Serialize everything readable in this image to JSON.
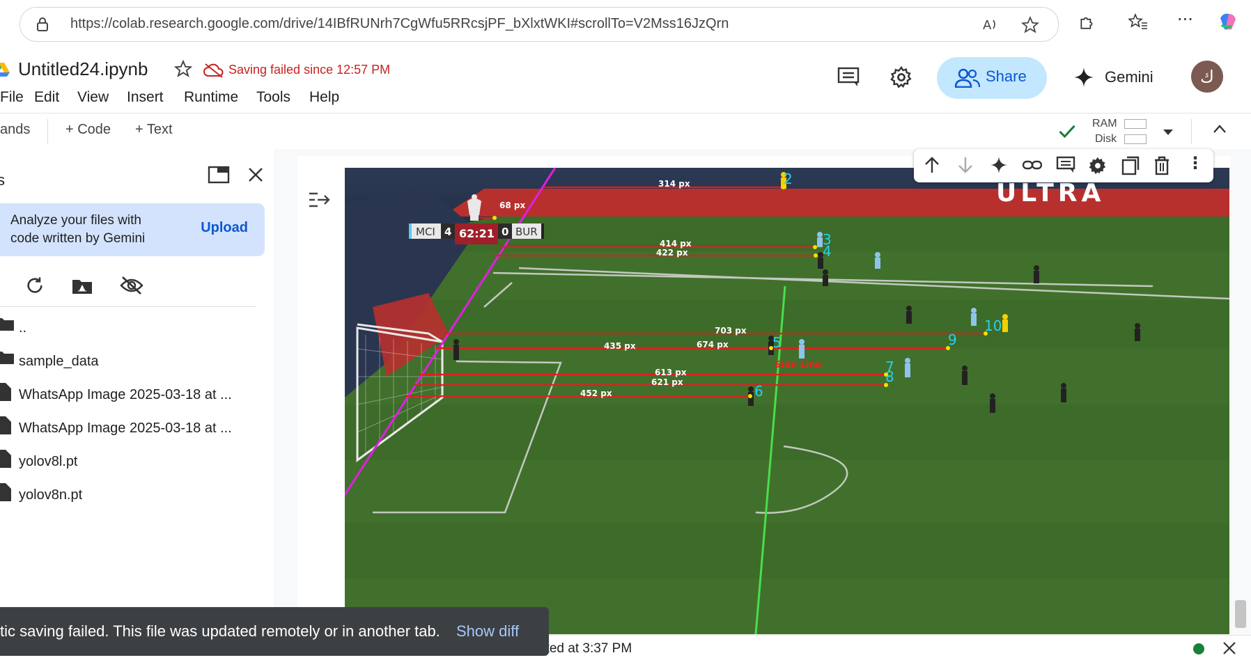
{
  "browser": {
    "url": "https://colab.research.google.com/drive/14IBfRUNrh7CgWfu5RRcsjPF_bXlxtWKI#scrollTo=V2Mss16JzQrn"
  },
  "notebook": {
    "title": "Untitled24.ipynb",
    "save_status": "Saving failed since 12:57 PM"
  },
  "menu": [
    "File",
    "Edit",
    "View",
    "Insert",
    "Runtime",
    "Tools",
    "Help"
  ],
  "header": {
    "share_label": "Share",
    "gemini_label": "Gemini",
    "avatar_letter": "ك"
  },
  "toolbar": {
    "commands_label": "ands",
    "code_label": "+ Code",
    "text_label": "+ Text",
    "ram_label": "RAM",
    "disk_label": "Disk"
  },
  "sidebar": {
    "title": "s",
    "gemini_prompt": "Analyze your files with code written by Gemini",
    "upload_label": "Upload",
    "files": [
      {
        "name": "..",
        "type": "folder"
      },
      {
        "name": "sample_data",
        "type": "folder"
      },
      {
        "name": "WhatsApp Image 2025-03-18 at ...",
        "type": "file"
      },
      {
        "name": "WhatsApp Image 2025-03-18 at ...",
        "type": "file"
      },
      {
        "name": "yolov8l.pt",
        "type": "file"
      },
      {
        "name": "yolov8n.pt",
        "type": "file"
      }
    ]
  },
  "output_image": {
    "scoreboard": {
      "home": "MCI",
      "home_score": "4",
      "clock": "62:21",
      "away_score": "0",
      "away": "BUR"
    },
    "billboard": "ULTRA",
    "side_line_label": "Side Line",
    "distances": [
      "314 px",
      "68 px",
      "414 px",
      "422 px",
      "703 px",
      "435 px",
      "674 px",
      "613 px",
      "621 px",
      "452 px"
    ],
    "player_ids": [
      "2",
      "3",
      "4",
      "5",
      "6",
      "7",
      "8",
      "9",
      "10"
    ]
  },
  "snackbar": {
    "message": "tic saving failed. This file was updated remotely or in another tab.",
    "action": "Show diff"
  },
  "status": {
    "text": "eted at 3:37 PM"
  }
}
